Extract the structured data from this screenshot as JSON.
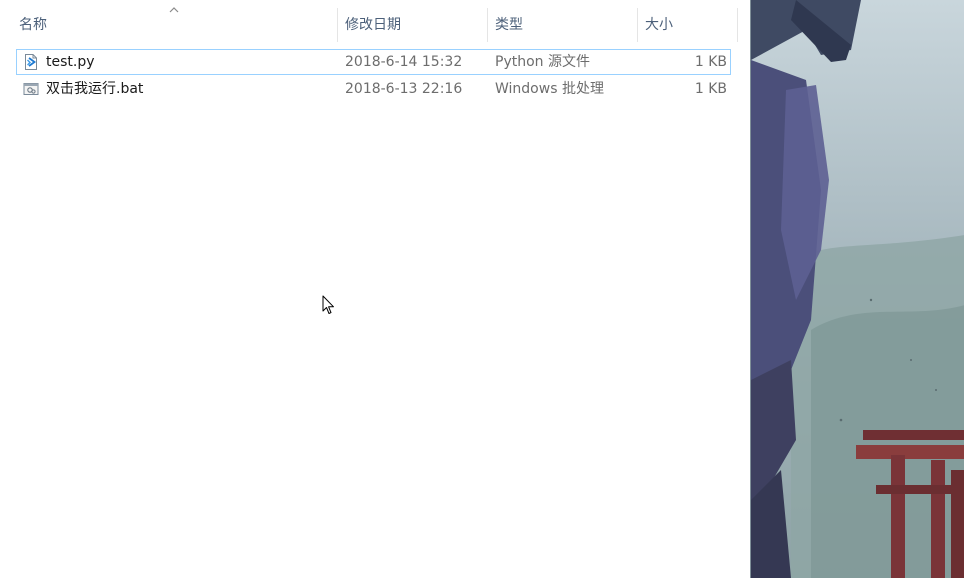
{
  "columns": {
    "name": "名称",
    "modified": "修改日期",
    "type": "类型",
    "size": "大小"
  },
  "files": [
    {
      "name": "test.py",
      "modified": "2018-6-14 15:32",
      "type": "Python 源文件",
      "size": "1 KB",
      "icon": "python-file-icon",
      "selected": true
    },
    {
      "name": "双击我运行.bat",
      "modified": "2018-6-13 22:16",
      "type": "Windows 批处理",
      "size": "1 KB",
      "icon": "batch-file-icon",
      "selected": false
    }
  ],
  "colors": {
    "header_text": "#4c607a",
    "selection_border": "#99d1ff",
    "detail_text": "#6d6d6d"
  }
}
